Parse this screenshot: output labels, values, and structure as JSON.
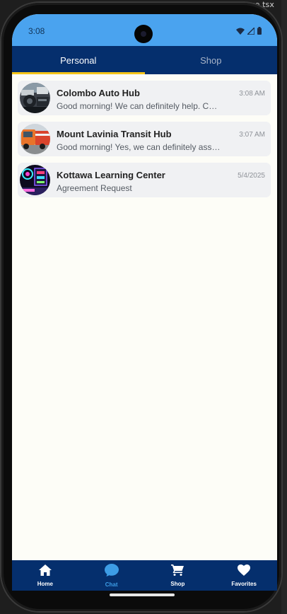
{
  "editor": {
    "tab_label": "...CatScPage.tsx"
  },
  "status_bar": {
    "time": "3:08",
    "icons": [
      "wifi-icon",
      "cellular-signal-icon",
      "battery-icon"
    ]
  },
  "tabs": [
    {
      "label": "Personal",
      "active": true
    },
    {
      "label": "Shop",
      "active": false
    }
  ],
  "chats": [
    {
      "name": "Colombo Auto Hub",
      "preview": "Good morning! We can definitely help. Could you share the details of your vehicle?",
      "time": "3:08 AM",
      "avatar": "car-engine-photo"
    },
    {
      "name": "Mount Lavinia Transit Hub",
      "preview": "Good morning! Yes, we can definitely assist you with the transport booking.",
      "time": "3:07 AM",
      "avatar": "orange-truck-photo"
    },
    {
      "name": "Kottawa Learning Center",
      "preview": "Agreement Request",
      "time": "5/4/2025",
      "avatar": "neon-computer-photo"
    }
  ],
  "bottom_nav": [
    {
      "label": "Home",
      "icon": "home-icon",
      "active": false
    },
    {
      "label": "Chat",
      "icon": "chat-bubble-icon",
      "active": true
    },
    {
      "label": "Shop",
      "icon": "shopping-cart-icon",
      "active": false
    },
    {
      "label": "Favorites",
      "icon": "heart-icon",
      "active": false
    }
  ],
  "colors": {
    "status_bar": "#4aa3ef",
    "header": "#052f6d",
    "tab_indicator": "#f5c518",
    "active_nav": "#3d9de6",
    "background": "#fdfdf7",
    "card": "#f0f1f3"
  }
}
